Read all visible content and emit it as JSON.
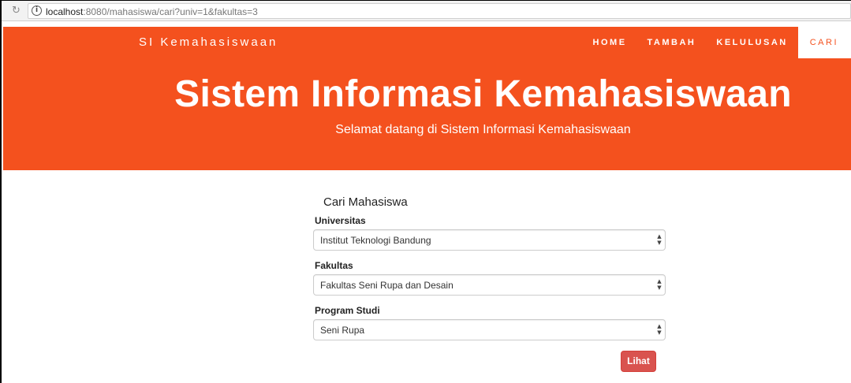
{
  "browser": {
    "url_host": "localhost",
    "url_rest": ":8080/mahasiswa/cari?univ=1&fakultas=3"
  },
  "navbar": {
    "brand": "SI Kemahasiswaan",
    "items": [
      "HOME",
      "TAMBAH",
      "KELULUSAN",
      "CARI"
    ],
    "active": "CARI"
  },
  "hero": {
    "title": "Sistem Informasi Kemahasiswaan",
    "subtitle": "Selamat datang di Sistem Informasi Kemahasiswaan"
  },
  "form": {
    "title": "Cari Mahasiswa",
    "universitas_label": "Universitas",
    "universitas_value": "Institut Teknologi Bandung",
    "fakultas_label": "Fakultas",
    "fakultas_value": "Fakultas Seni Rupa dan Desain",
    "prodi_label": "Program Studi",
    "prodi_value": "Seni Rupa",
    "submit_label": "Lihat"
  },
  "colors": {
    "brand": "#f4511e",
    "button": "#d9534f"
  }
}
